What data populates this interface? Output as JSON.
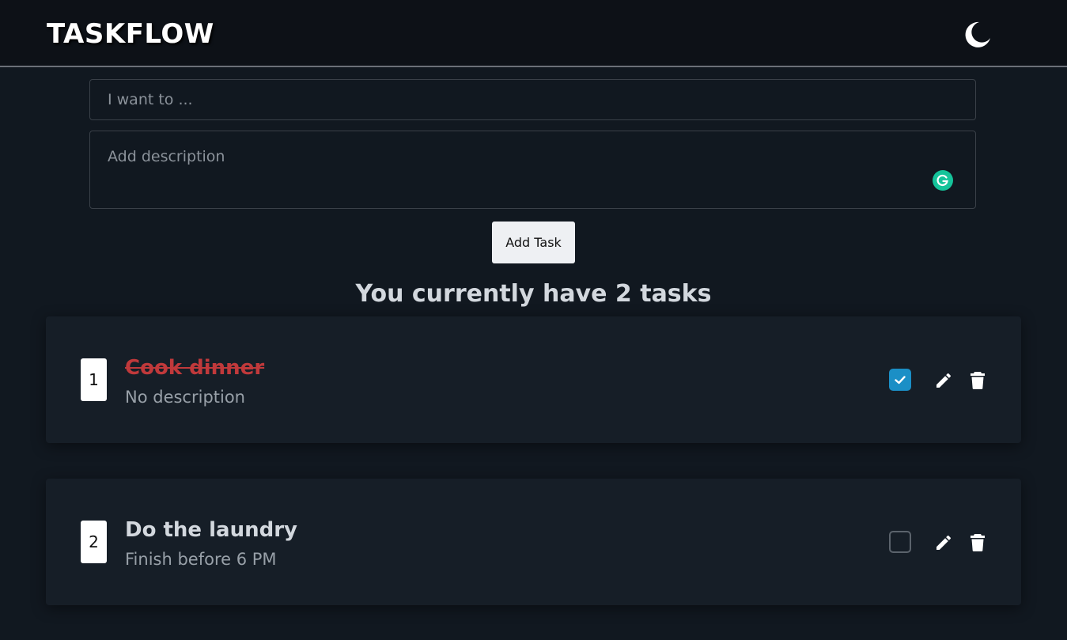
{
  "header": {
    "brand": "TASKFLOW",
    "theme_icon": "moon-icon"
  },
  "form": {
    "task_placeholder": "I want to ...",
    "task_value": "",
    "description_placeholder": "Add description",
    "description_value": "",
    "add_button_label": "Add Task",
    "grammarly_icon": "grammarly-icon"
  },
  "summary": {
    "heading": "You currently have 2 tasks"
  },
  "tasks": [
    {
      "number": "1",
      "title": "Cook dinner",
      "description": "No description",
      "completed": true
    },
    {
      "number": "2",
      "title": "Do the laundry",
      "description": "Finish before 6 PM",
      "completed": false
    }
  ],
  "colors": {
    "background": "#111820",
    "card": "#161e27",
    "accent_checkbox": "#1b8fc6",
    "completed_title": "#c0393b",
    "grammarly": "#15c39a"
  }
}
